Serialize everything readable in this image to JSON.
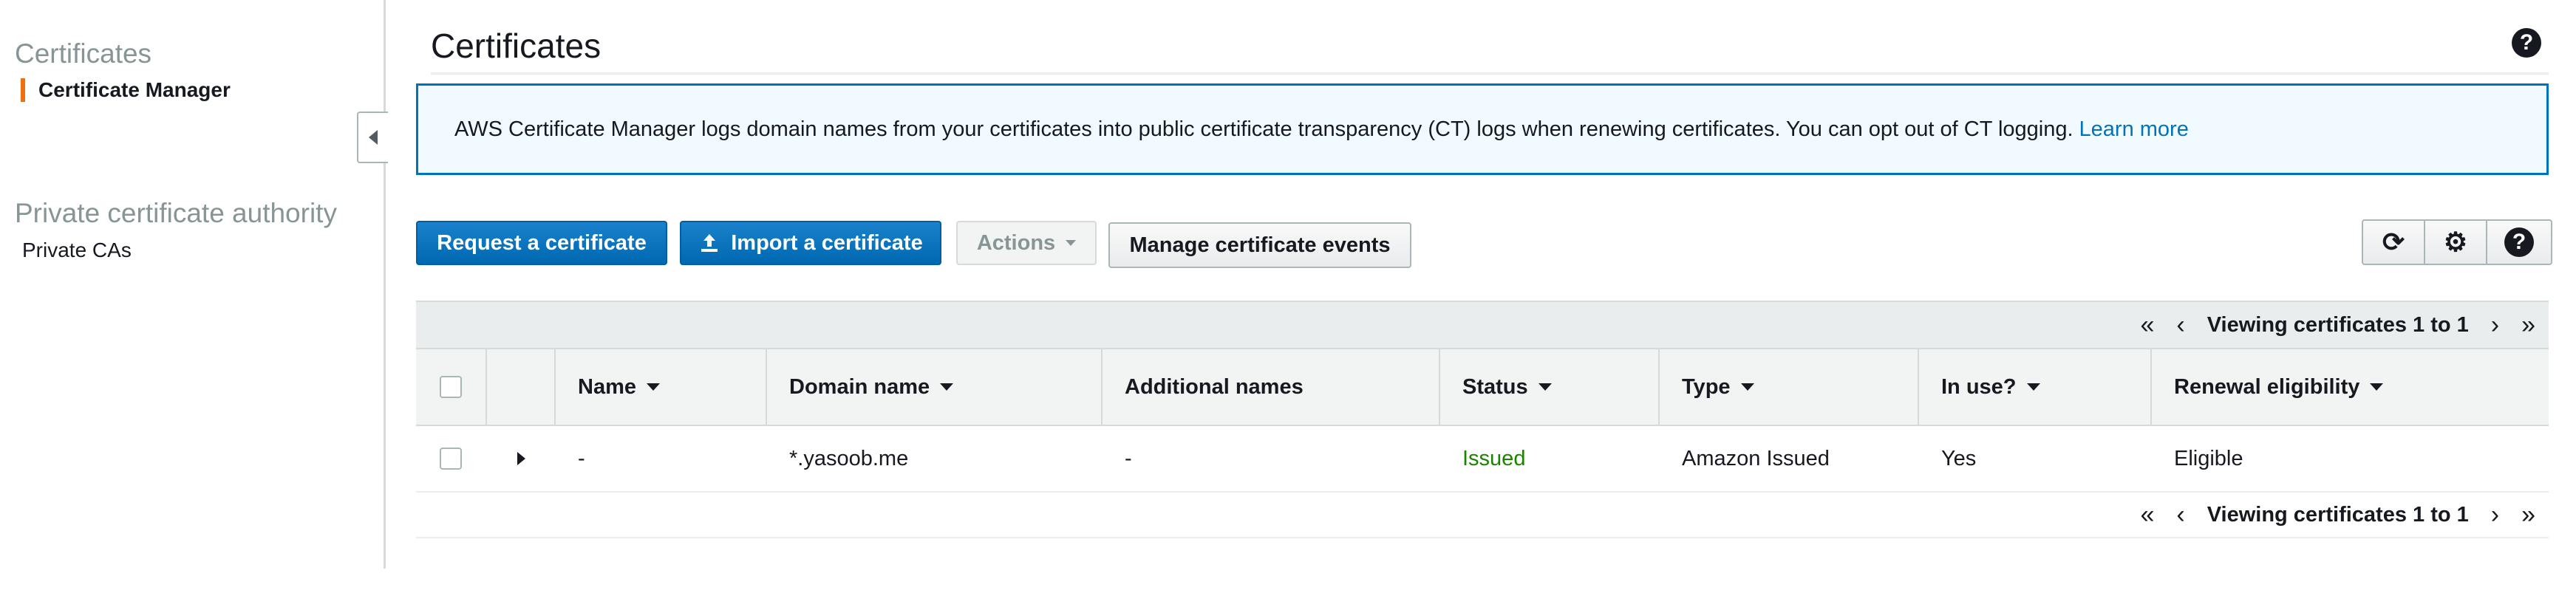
{
  "sidebar": {
    "section_certificates": "Certificates",
    "item_certificate_manager": "Certificate Manager",
    "section_private_ca": "Private certificate authority",
    "item_private_cas": "Private CAs"
  },
  "header": {
    "title": "Certificates",
    "help_glyph": "?"
  },
  "banner": {
    "text": "AWS Certificate Manager logs domain names from your certificates into public certificate transparency (CT) logs when renewing certificates. You can opt out of CT logging.",
    "link": "Learn more"
  },
  "toolbar": {
    "request_label": "Request a certificate",
    "import_label": "Import a certificate",
    "actions_label": "Actions",
    "manage_events_label": "Manage certificate events",
    "refresh_glyph": "⟳",
    "settings_glyph": "⚙",
    "help_glyph": "?"
  },
  "pager": {
    "info": "Viewing certificates 1 to 1",
    "first": "«",
    "prev": "‹",
    "next": "›",
    "last": "»"
  },
  "table": {
    "columns": {
      "name": "Name",
      "domain": "Domain name",
      "additional": "Additional names",
      "status": "Status",
      "type": "Type",
      "in_use": "In use?",
      "renewal": "Renewal eligibility"
    },
    "rows": [
      {
        "name": "-",
        "domain": "*.yasoob.me",
        "additional": "-",
        "status": "Issued",
        "type": "Amazon Issued",
        "in_use": "Yes",
        "renewal": "Eligible"
      }
    ]
  },
  "colors": {
    "primary": "#0073bb",
    "accent_orange": "#ec7211",
    "status_green": "#1d8102"
  }
}
